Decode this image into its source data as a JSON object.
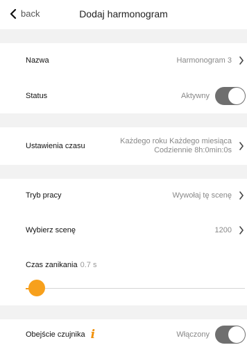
{
  "header": {
    "back_label": "back",
    "title": "Dodaj harmonogram"
  },
  "rows": {
    "name": {
      "label": "Nazwa",
      "value": "Harmonogram 3"
    },
    "status": {
      "label": "Status",
      "value": "Aktywny",
      "toggle_on": true
    },
    "time": {
      "label": "Ustawienia czasu",
      "value_line1": "Każdego roku Każdego miesiąca",
      "value_line2": "Codziennie 8h:0min:0s"
    },
    "mode": {
      "label": "Tryb pracy",
      "value": "Wywołaj tę scenę"
    },
    "scene": {
      "label": "Wybierz scenę",
      "value": "1200"
    },
    "fade": {
      "label": "Czas zanikania",
      "value": "0.7 s",
      "slider_fraction": 0.05
    },
    "sensor": {
      "label": "Obejście czujnika",
      "value": "Włączony",
      "toggle_on": true
    }
  },
  "colors": {
    "accent": "#f7a01c",
    "toggle": "#6f6f6f",
    "separator": "#f2f2f2"
  },
  "icons": {
    "back": "chevron-left-icon",
    "info": "info-icon",
    "next": "chevron-right-icon"
  }
}
